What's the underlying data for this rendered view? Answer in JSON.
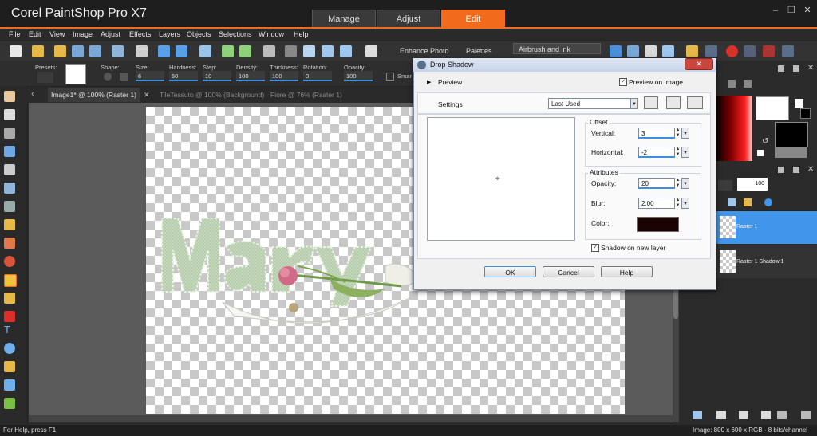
{
  "app": {
    "title": "Corel PaintShop Pro X7"
  },
  "workspace_tabs": [
    {
      "label": "Manage"
    },
    {
      "label": "Adjust"
    },
    {
      "label": "Edit"
    }
  ],
  "menu": [
    "File",
    "Edit",
    "View",
    "Image",
    "Adjust",
    "Effects",
    "Layers",
    "Objects",
    "Selections",
    "Window",
    "Help"
  ],
  "toolbar": {
    "enhance_photo": "Enhance Photo",
    "palettes": "Palettes",
    "brush_preset": "Airbrush and ink"
  },
  "tool_options": {
    "presets_label": "Presets:",
    "shape_label": "Shape:",
    "size_label": "Size:",
    "size_value": "6",
    "hardness_label": "Hardness:",
    "hardness_value": "50",
    "step_label": "Step:",
    "step_value": "10",
    "density_label": "Density:",
    "density_value": "100",
    "thickness_label": "Thickness:",
    "thickness_value": "100",
    "rotation_label": "Rotation:",
    "rotation_value": "0",
    "opacity_label": "Opacity:",
    "opacity_value": "100",
    "smart_label": "Smar"
  },
  "doc_tabs": [
    {
      "label": "Image1* @ 100% (Raster 1)",
      "active": true
    },
    {
      "label": "TileTessuto @ 100% (Background)",
      "active": false
    },
    {
      "label": "Fiore @  76% (Raster 1)",
      "active": false
    }
  ],
  "dialog": {
    "title": "Drop Shadow",
    "preview_label": "Preview",
    "preview_on_image_label": "Preview on Image",
    "preview_on_image_checked": true,
    "settings_label": "Settings",
    "settings_value": "Last Used",
    "offset_title": "Offset",
    "vertical_label": "Vertical:",
    "vertical_value": "3",
    "horizontal_label": "Horizontal:",
    "horizontal_value": "-2",
    "attributes_title": "Attributes",
    "opacity_label": "Opacity:",
    "opacity_value": "20",
    "blur_label": "Blur:",
    "blur_value": "2.00",
    "color_label": "Color:",
    "shadow_color": "#1a0300",
    "shadow_new_layer_label": "Shadow on new layer",
    "shadow_new_layer_checked": true,
    "ok_label": "OK",
    "cancel_label": "Cancel",
    "help_label": "Help"
  },
  "layers": {
    "opacity_value": "100",
    "items": [
      {
        "name": "Raster 1",
        "selected": true
      },
      {
        "name": "Raster 1 Shadow 1",
        "selected": false
      }
    ]
  },
  "status": {
    "help_text": "For Help, press F1",
    "image_info": "Image:  800 x 600 x RGB - 8 bits/channel"
  },
  "colors": {
    "accent": "#f26b1d",
    "layer_selected": "#3f96ea",
    "workspace_bg": "#5b5b5b"
  }
}
